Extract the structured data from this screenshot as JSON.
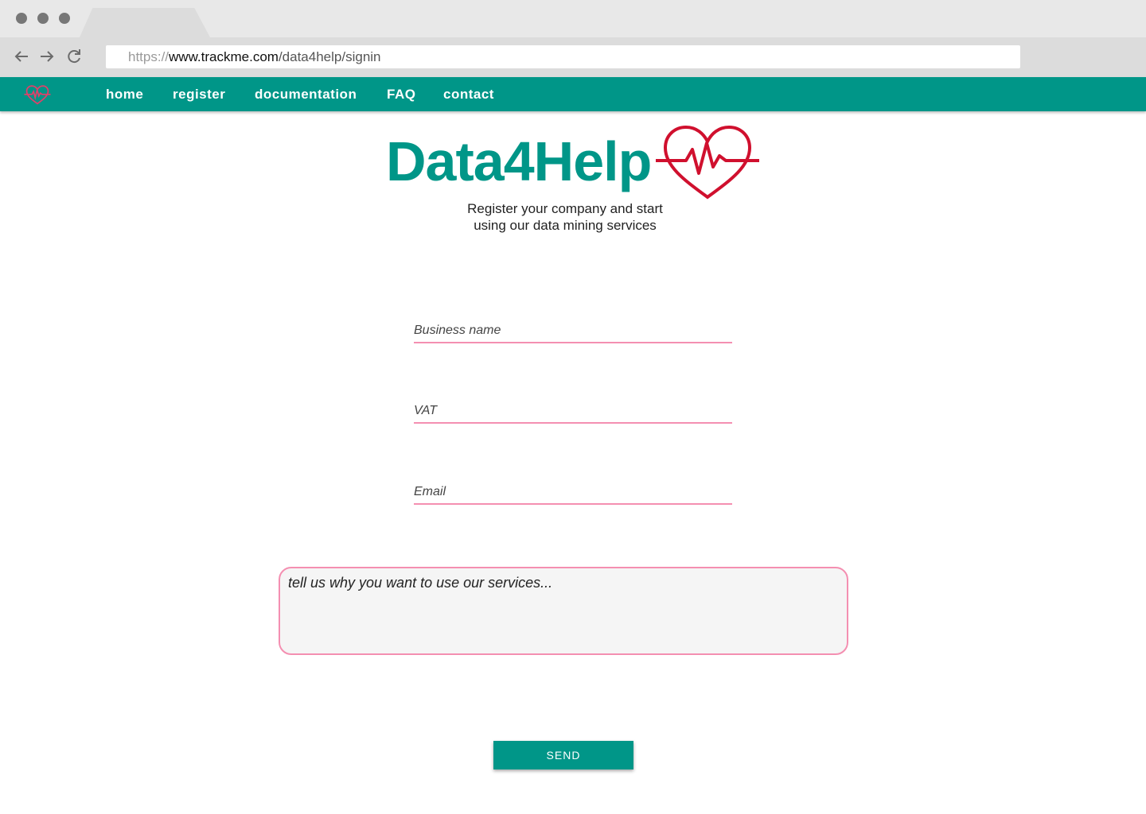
{
  "browser": {
    "url_protocol": "https://",
    "url_host": "www.trackme.com",
    "url_path": "/data4help/signin",
    "back_icon": "arrow-left-icon",
    "forward_icon": "arrow-right-icon",
    "reload_icon": "reload-icon"
  },
  "nav": {
    "logo_icon": "heartbeat-icon",
    "links": [
      {
        "label": "home"
      },
      {
        "label": "register"
      },
      {
        "label": "documentation"
      },
      {
        "label": "FAQ"
      },
      {
        "label": "contact"
      }
    ]
  },
  "hero": {
    "brand": "Data4Help",
    "tagline_line1": "Register your company and start",
    "tagline_line2": "using our data mining services"
  },
  "form": {
    "business_name_placeholder": "Business name",
    "vat_placeholder": "VAT",
    "email_placeholder": "Email",
    "message_placeholder": "tell us why you want to use our services...",
    "send_label": "SEND"
  },
  "colors": {
    "primary": "#009688",
    "accent_pink": "#f48fb1",
    "heart_red": "#d0102e"
  }
}
